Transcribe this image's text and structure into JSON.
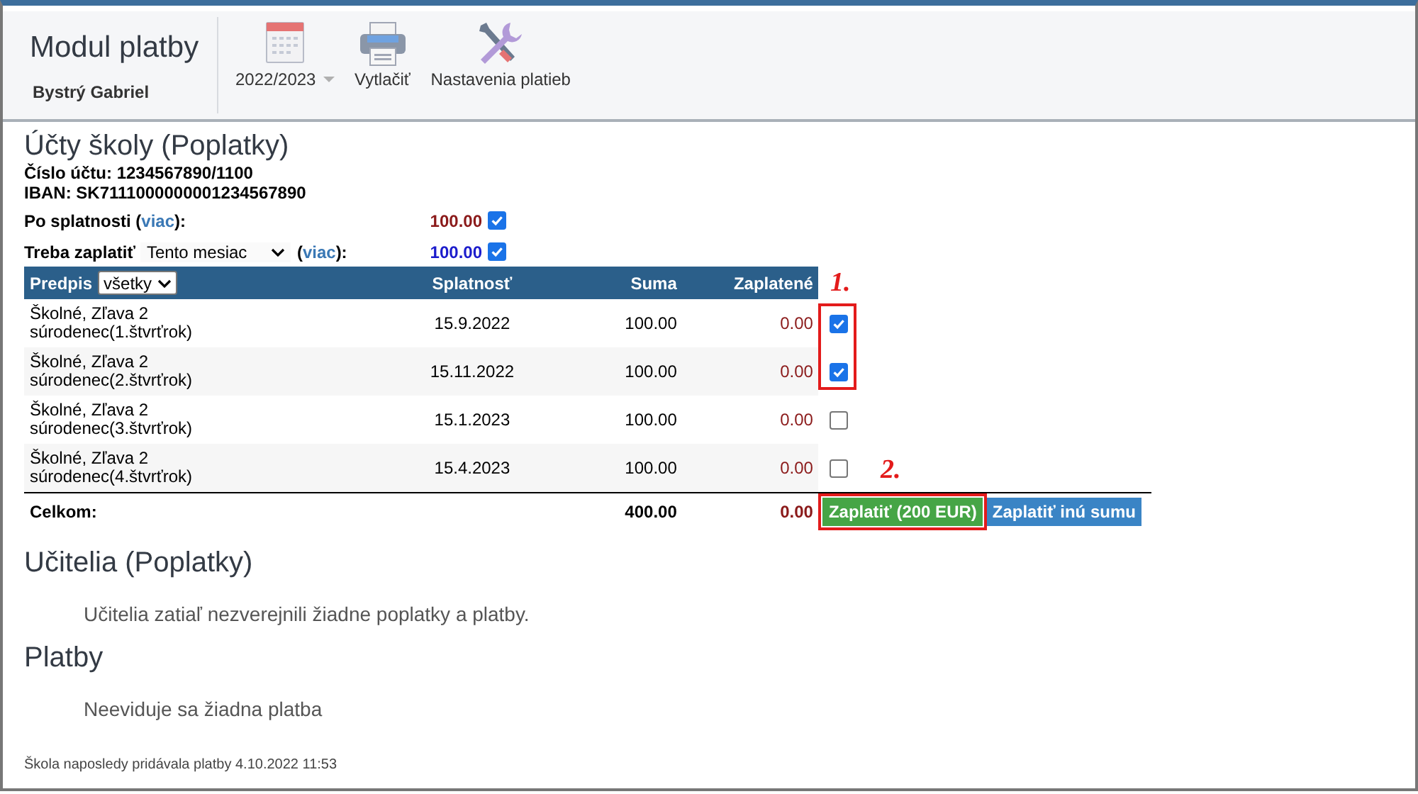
{
  "header": {
    "title": "Modul platby",
    "user": "Bystrý Gabriel",
    "toolbar": [
      {
        "kind": "dropdown",
        "label": "2022/2023"
      },
      {
        "kind": "button",
        "label": "Vytlačiť"
      },
      {
        "kind": "button",
        "label": "Nastavenia platieb"
      }
    ]
  },
  "school_accounts": {
    "title": "Účty školy (Poplatky)",
    "account_number": "Číslo účtu: 1234567890/1100",
    "iban": "IBAN: SK7111000000001234567890",
    "overdue": {
      "label": "Po splatnosti (",
      "link": "viac",
      "label_end": "):",
      "amount": "100.00",
      "checked": true
    },
    "to_pay": {
      "label": "Treba zaplatiť",
      "select": "Tento mesiac",
      "paren": "(",
      "link": "viac",
      "label_end": "):",
      "amount": "100.00",
      "checked": true
    },
    "table": {
      "columns": [
        "Predpis",
        "Splatnosť",
        "Suma",
        "Zaplatené"
      ],
      "filter": "všetky",
      "mark": "1.",
      "rows": [
        {
          "item": "Školné, Zľava 2 súrodenec(1.štvrťrok)",
          "due": "15.9.2022",
          "amount": "100.00",
          "paid": "0.00",
          "checked": true,
          "highlighted": true
        },
        {
          "item": "Školné, Zľava 2 súrodenec(2.štvrťrok)",
          "due": "15.11.2022",
          "amount": "100.00",
          "paid": "0.00",
          "checked": true,
          "highlighted": true
        },
        {
          "item": "Školné, Zľava 2 súrodenec(3.štvrťrok)",
          "due": "15.1.2023",
          "amount": "100.00",
          "paid": "0.00",
          "checked": false,
          "highlighted": false
        },
        {
          "item": "Školné, Zľava 2 súrodenec(4.štvrťrok)",
          "due": "15.4.2023",
          "amount": "100.00",
          "paid": "0.00",
          "checked": false,
          "highlighted": false
        }
      ],
      "total": {
        "label": "Celkom:",
        "amount": "400.00",
        "paid": "0.00"
      },
      "mark_2": "2.",
      "buttons": [
        {
          "kind": "pay",
          "label": "Zaplatiť (200 EUR)",
          "highlighted": true
        },
        {
          "kind": "other",
          "label": "Zaplatiť inú sumu",
          "highlighted": false
        }
      ]
    }
  },
  "teachers": {
    "title": "Učitelia (Poplatky)",
    "message": "Učitelia zatiaľ nezverejnili žiadne poplatky a platby."
  },
  "payments": {
    "title": "Platby",
    "message": "Neeviduje sa žiadna platba"
  },
  "footer": "Škola naposledy pridávala platby 4.10.2022 11:53"
}
